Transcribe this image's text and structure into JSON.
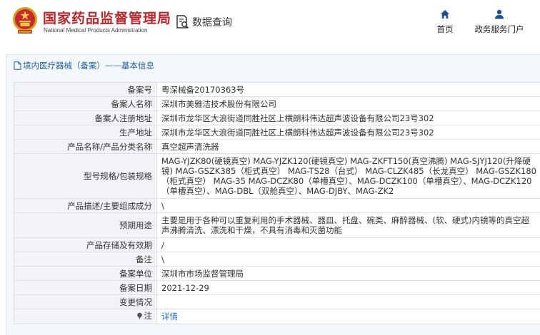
{
  "header": {
    "title": "国家药品监督管理局",
    "subtitle": "National Medical Products Administration",
    "query_label": "数据查询",
    "nav": {
      "home": "首页",
      "portal": "政务服务门户"
    },
    "colors": {
      "brand": "#b9262a",
      "nav_icon": "#1f4e9a"
    }
  },
  "breadcrumb": {
    "text": "境内医疗器械（备案）——基本信息"
  },
  "rows": [
    {
      "label": "备案号",
      "value": "粤深械备20170363号"
    },
    {
      "label": "备案人名称",
      "value": "深圳市美雅洁技术股份有限公司"
    },
    {
      "label": "备案人注册地址",
      "value": "深圳市龙华区大浪街道同胜社区上横朗科伟达超声波设备有限公司23号302"
    },
    {
      "label": "生产地址",
      "value": "深圳市龙华区大浪街道同胜社区上横朗科伟达超声波设备有限公司23号302"
    },
    {
      "label": "产品名称/产品分类名称",
      "value": "真空超声清洗器"
    },
    {
      "label": "型号规格/包装规格",
      "value": "MAG-YJZK80(硬镜真空) MAG-YJZK120(硬镜真空) MAG-ZKFT150(真空沸腾) MAG-SJYJ120(升降硬镜) MAG-GSZK385（柜式真空） MAG-TS28（台式） MAG-CLZK485（长龙真空） MAG-GSZK180（柜式真空） MAG-35 MAG-DCZK80（单槽真空）、MAG-DCZK100（单槽真空）、MAG-DCZK120（单槽真空）、MAG-DBL（双舱真空）、MAG-DJBY、MAG-ZK2"
    },
    {
      "label": "产品描述/主要组成成分",
      "value": "\\"
    },
    {
      "label": "预期用途",
      "value": "主要是用于各种可以重复利用的手术器械、器皿、托盘、碗类、麻醉器械、(软、硬式)内镜等的真空超声沸腾清洗、漂洗和干燥，不具有消毒和灭菌功能"
    },
    {
      "label": "产品存储及有效期",
      "value": "/"
    },
    {
      "label": "备注",
      "value": "\\"
    },
    {
      "label": "备案单位",
      "value": "深圳市市场监督管理局"
    },
    {
      "label": "备案日期",
      "value": "2021-12-29"
    },
    {
      "label": "变更情况",
      "value": ""
    }
  ],
  "note": {
    "label": "注",
    "link": "详情",
    "icon": "pin-icon"
  }
}
